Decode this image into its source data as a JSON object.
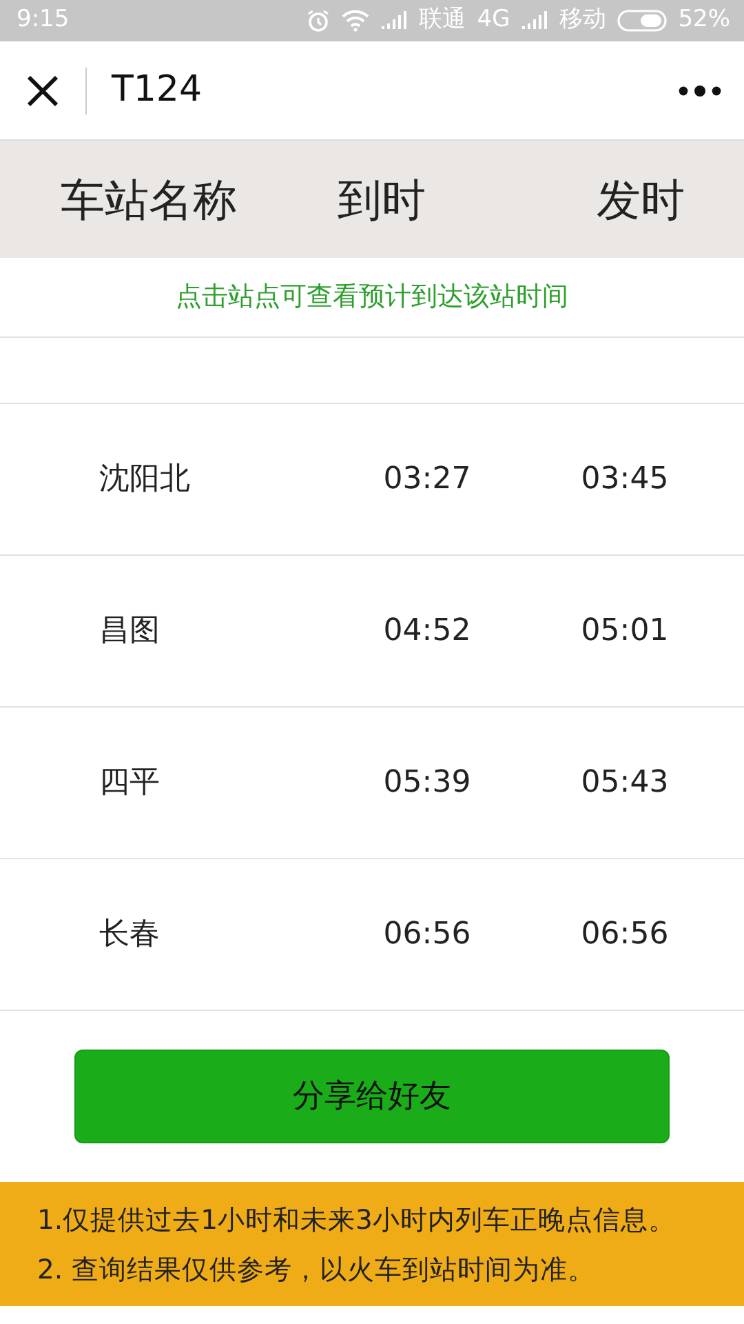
{
  "status_bar": {
    "time": "9:15",
    "carrier_1": "联通",
    "network": "4G",
    "carrier_2": "移动",
    "battery": "52%"
  },
  "nav_bar": {
    "title": "T124"
  },
  "table": {
    "columns": [
      "车站名称",
      "到时",
      "发时"
    ],
    "hint": "点击站点可查看预计到达该站时间",
    "rows": [
      {
        "station": "沈阳北",
        "arrive": "03:27",
        "depart": "03:45"
      },
      {
        "station": "昌图",
        "arrive": "04:52",
        "depart": "05:01"
      },
      {
        "station": "四平",
        "arrive": "05:39",
        "depart": "05:43"
      },
      {
        "station": "长春",
        "arrive": "06:56",
        "depart": "06:56"
      }
    ]
  },
  "share_button": "分享给好友",
  "notes": [
    "1.仅提供过去1小时和未来3小时内列车正晚点信息。",
    "2. 查询结果仅供参考，以火车到站时间为准。"
  ]
}
